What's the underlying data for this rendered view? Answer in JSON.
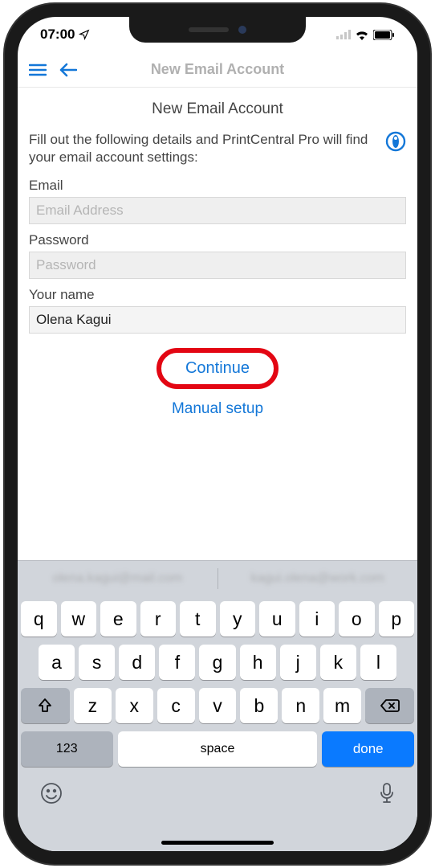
{
  "statusbar": {
    "time": "07:00"
  },
  "navbar": {
    "title": "New Email Account"
  },
  "page": {
    "title": "New Email Account",
    "description": "Fill out the following details and PrintCentral Pro will find your email account settings:"
  },
  "fields": {
    "email": {
      "label": "Email",
      "placeholder": "Email Address",
      "value": ""
    },
    "password": {
      "label": "Password",
      "placeholder": "Password",
      "value": ""
    },
    "name": {
      "label": "Your name",
      "placeholder": "",
      "value": "Olena Kagui"
    }
  },
  "buttons": {
    "continue": "Continue",
    "manual": "Manual setup"
  },
  "keyboard": {
    "suggestions": [
      "olena.kagui@mail.com",
      "kagui.olena@work.com"
    ],
    "row1": [
      "q",
      "w",
      "e",
      "r",
      "t",
      "y",
      "u",
      "i",
      "o",
      "p"
    ],
    "row2": [
      "a",
      "s",
      "d",
      "f",
      "g",
      "h",
      "j",
      "k",
      "l"
    ],
    "row3": [
      "z",
      "x",
      "c",
      "v",
      "b",
      "n",
      "m"
    ],
    "numKey": "123",
    "space": "space",
    "done": "done"
  }
}
